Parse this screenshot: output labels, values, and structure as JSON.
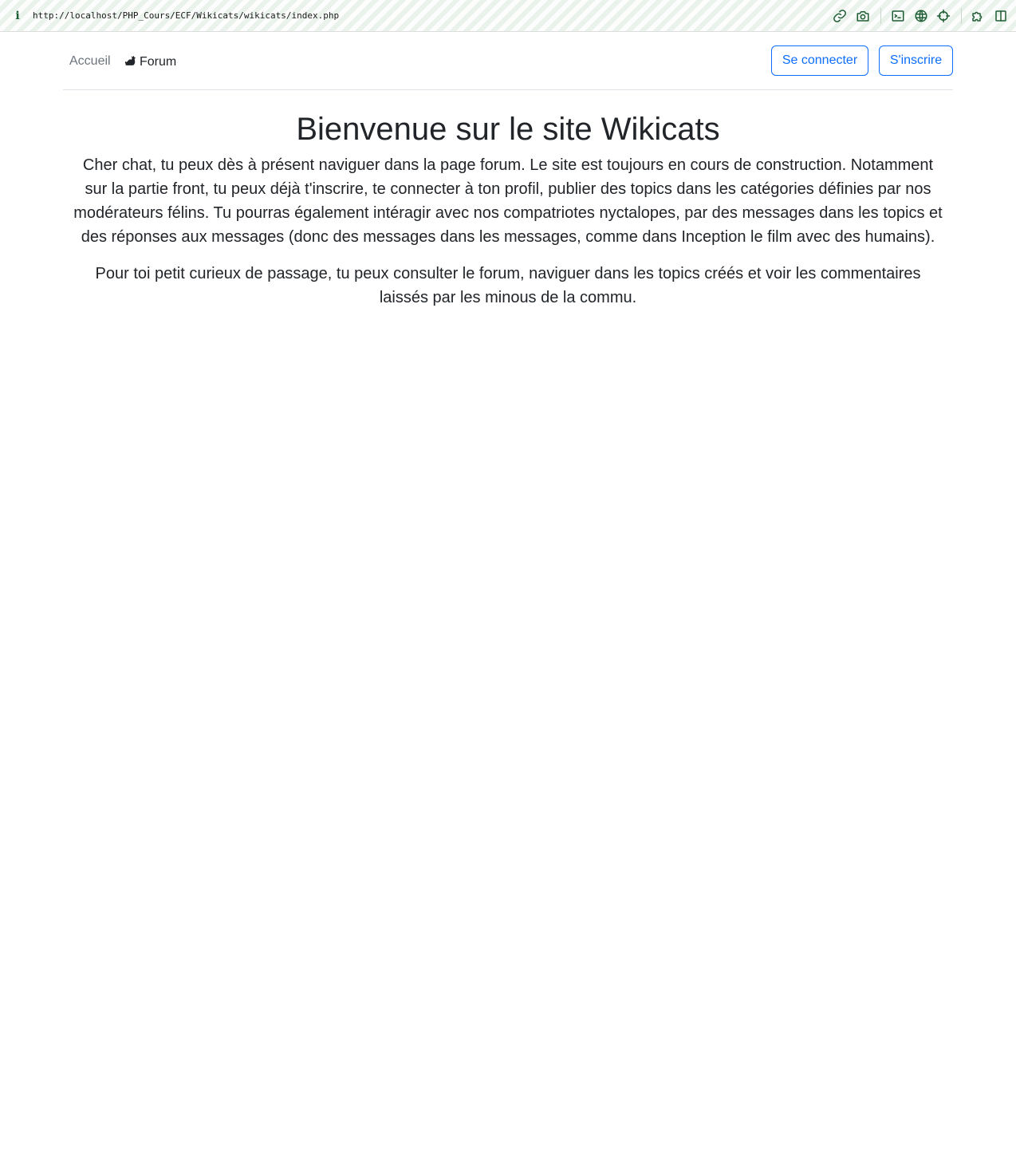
{
  "browser": {
    "url": "http://localhost/PHP_Cours/ECF/Wikicats/wikicats/index.php",
    "info_icon": "i",
    "toolbar_icons": [
      "link-icon",
      "camera-icon",
      "terminal-icon",
      "globe-icon",
      "crosshair-icon",
      "puzzle-icon",
      "sidebar-icon"
    ],
    "accent_color": "#1e5d33"
  },
  "navbar": {
    "links": [
      {
        "label": "Accueil",
        "active": false
      },
      {
        "label": "Forum",
        "icon": "cat-icon",
        "active": true
      }
    ],
    "login_label": "Se connecter",
    "signup_label": "S'inscrire",
    "button_color": "#0d6efd"
  },
  "main": {
    "title": "Bienvenue sur le site Wikicats",
    "paragraphs": [
      "Cher chat, tu peux dès à présent naviguer dans la page forum. Le site est toujours en cours de construction. Notamment sur la partie front, tu peux déjà t'inscrire, te connecter à ton profil, publier des topics dans les catégories définies par nos modérateurs félins. Tu pourras également intéragir avec nos compatriotes nyctalopes, par des messages dans les topics et des réponses aux messages (donc des messages dans les messages, comme dans Inception le film avec des humains).",
      "Pour toi petit curieux de passage, tu peux consulter le forum, naviguer dans les topics créés et voir les commentaires laissés par les minous de la commu."
    ]
  }
}
